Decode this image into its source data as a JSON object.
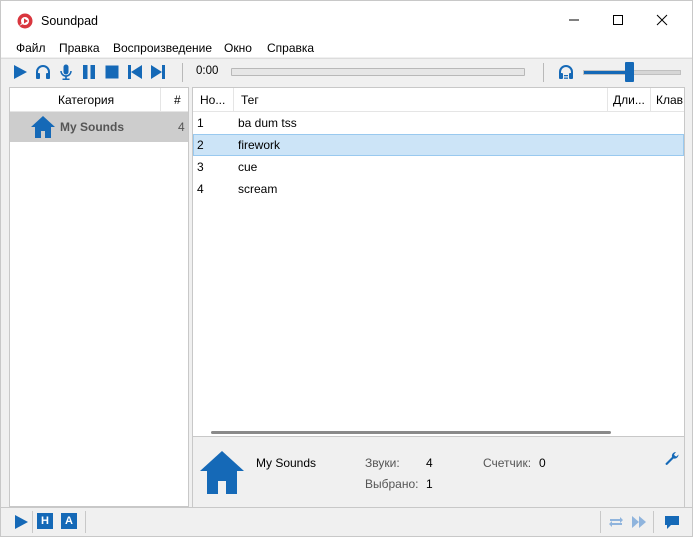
{
  "window": {
    "title": "Soundpad"
  },
  "menu": [
    "Файл",
    "Правка",
    "Воспроизведение",
    "Окно",
    "Справка"
  ],
  "player": {
    "time": "0:00",
    "progress": 0,
    "volume": 0.47
  },
  "categories": {
    "header_name": "Категория",
    "header_count": "#",
    "items": [
      {
        "name": "My Sounds",
        "count": "4"
      }
    ]
  },
  "sounds": {
    "columns": [
      "Но...",
      "Тег",
      "Дли...",
      "Клав"
    ],
    "rows": [
      {
        "num": "1",
        "tag": "ba dum tss"
      },
      {
        "num": "2",
        "tag": "firework"
      },
      {
        "num": "3",
        "tag": "cue"
      },
      {
        "num": "4",
        "tag": "scream"
      }
    ],
    "selected_index": 1
  },
  "info": {
    "category": "My Sounds",
    "sounds_label": "Звуки:",
    "sounds_value": "4",
    "counter_label": "Счетчик:",
    "counter_value": "0",
    "selected_label": "Выбрано:",
    "selected_value": "1"
  },
  "statusbar": {
    "letter_h": "H",
    "letter_a": "A"
  },
  "colors": {
    "accent": "#1569b7",
    "selection": "#cce4f7",
    "app_icon": "#d9363e"
  }
}
